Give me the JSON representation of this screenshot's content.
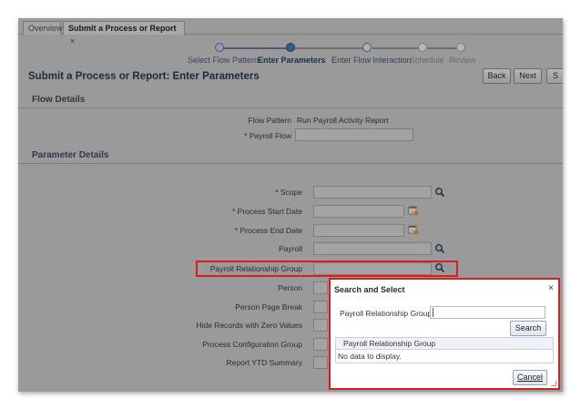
{
  "tabs": [
    {
      "label": "Overview"
    },
    {
      "label": "Submit a Process or Report",
      "close": "×"
    }
  ],
  "train": {
    "steps": [
      {
        "label": "Select Flow Pattern",
        "state": "visited"
      },
      {
        "label": "Enter Parameters",
        "state": "current"
      },
      {
        "label": "Enter Flow Interaction",
        "state": "next"
      },
      {
        "label": "Schedule",
        "state": "disabled"
      },
      {
        "label": "Review",
        "state": "disabled"
      }
    ]
  },
  "header": {
    "title": "Submit a Process or Report: Enter Parameters",
    "back_label": "Back",
    "next_label": "Next",
    "more_label": "S"
  },
  "flow_details": {
    "heading": "Flow Details",
    "flow_pattern_label": "Flow Pattern",
    "flow_pattern_value": "Run Payroll Activity Report",
    "payroll_flow_label": "* Payroll Flow",
    "payroll_flow_value": ""
  },
  "parameter_details": {
    "heading": "Parameter Details",
    "fields": [
      {
        "label": "* Scope",
        "icon": "search-icon"
      },
      {
        "label": "* Process Start Date",
        "icon": "calendar-icon"
      },
      {
        "label": "* Process End Date",
        "icon": "calendar-icon"
      },
      {
        "label": "Payroll",
        "icon": "search-icon"
      },
      {
        "label": "Payroll Relationship Group",
        "icon": "search-icon"
      },
      {
        "label": "Person"
      },
      {
        "label": "Person Page Break"
      },
      {
        "label": "Hide Records with Zero Values"
      },
      {
        "label": "Process Configuration Group"
      },
      {
        "label": "Report YTD Summary"
      }
    ]
  },
  "dialog": {
    "title": "Search and Select",
    "close": "×",
    "search_label": "Payroll Relationship Group",
    "search_value": "",
    "search_button": "Search",
    "column_header": "Payroll Relationship Group",
    "empty_text": "No data to display.",
    "cancel_button": "Cancel"
  },
  "colors": {
    "highlight": "#d42020",
    "title_text": "#1f2a3a",
    "train_current": "#2f5f8f"
  }
}
